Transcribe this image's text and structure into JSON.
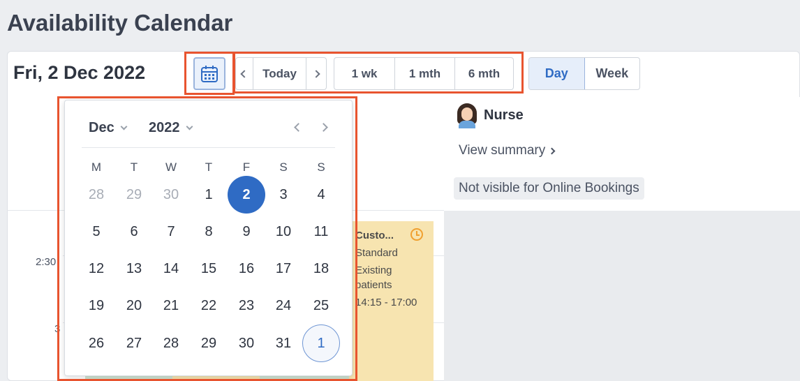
{
  "page": {
    "title": "Availability Calendar"
  },
  "toolbar": {
    "current_date": "Fri, 2 Dec 2022",
    "today_label": "Today",
    "jumps": [
      "1 wk",
      "1 mth",
      "6 mth"
    ],
    "views": {
      "day": "Day",
      "week": "Week",
      "active": "Day"
    }
  },
  "practitioner": {
    "name": "Nurse",
    "view_summary": "View summary",
    "visibility": "Not visible for Online Bookings"
  },
  "schedule": {
    "time_labels": [
      "2:30",
      "3"
    ],
    "appointment": {
      "title": "Custo...",
      "type": "Standard",
      "patients_line1": "Existing",
      "patients_line2": "patients",
      "time": "14:15 - 17:00"
    }
  },
  "date_picker": {
    "month": "Dec",
    "year": "2022",
    "weekdays": [
      "M",
      "T",
      "W",
      "T",
      "F",
      "S",
      "S"
    ],
    "weeks": [
      [
        "28",
        "29",
        "30",
        "1",
        "2",
        "3",
        "4"
      ],
      [
        "5",
        "6",
        "7",
        "8",
        "9",
        "10",
        "11"
      ],
      [
        "12",
        "13",
        "14",
        "15",
        "16",
        "17",
        "18"
      ],
      [
        "19",
        "20",
        "21",
        "22",
        "23",
        "24",
        "25"
      ],
      [
        "26",
        "27",
        "28",
        "29",
        "30",
        "31",
        "1"
      ]
    ],
    "selected_day": "2"
  },
  "colors": {
    "accent": "#2f6bc4",
    "highlight": "#e8542f",
    "appointment": "#f7e4b0"
  }
}
